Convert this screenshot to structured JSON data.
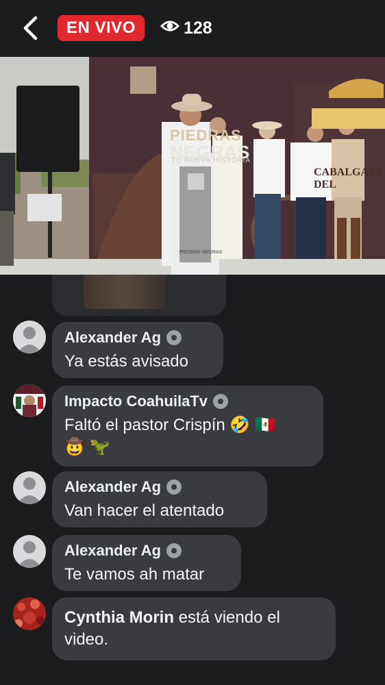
{
  "header": {
    "live_label": "EN VIVO",
    "viewer_count": "128"
  },
  "video": {
    "brand_line1": "PIEDRAS",
    "brand_line2": "NEGRAS",
    "brand_tagline": "TU NUEVA HISTORIA",
    "banner_text": "CABALGATA DEL",
    "podium_label": "PIEDRAS NEGRAS"
  },
  "comments": [
    {
      "author": "Alexander Ag",
      "text": "Ya estás avisado",
      "avatar": "default-avatar"
    },
    {
      "author": "Impacto CoahuilaTv",
      "text": "Faltó el pastor Crispín 🤣 🇲🇽",
      "text2": "🤠 🦖",
      "avatar": "photo-avatar"
    },
    {
      "author": "Alexander Ag",
      "text": "Van hacer el atentado",
      "avatar": "default-avatar"
    },
    {
      "author": "Alexander Ag",
      "text": "Te vamos ah matar",
      "avatar": "default-avatar"
    }
  ],
  "join_event": {
    "name": "Cynthia Morin",
    "suffix": " está viendo el",
    "suffix2": "video."
  },
  "colors": {
    "background": "#1b1c1e",
    "bubble": "#3a3b3e",
    "live_red": "#e0282e"
  }
}
